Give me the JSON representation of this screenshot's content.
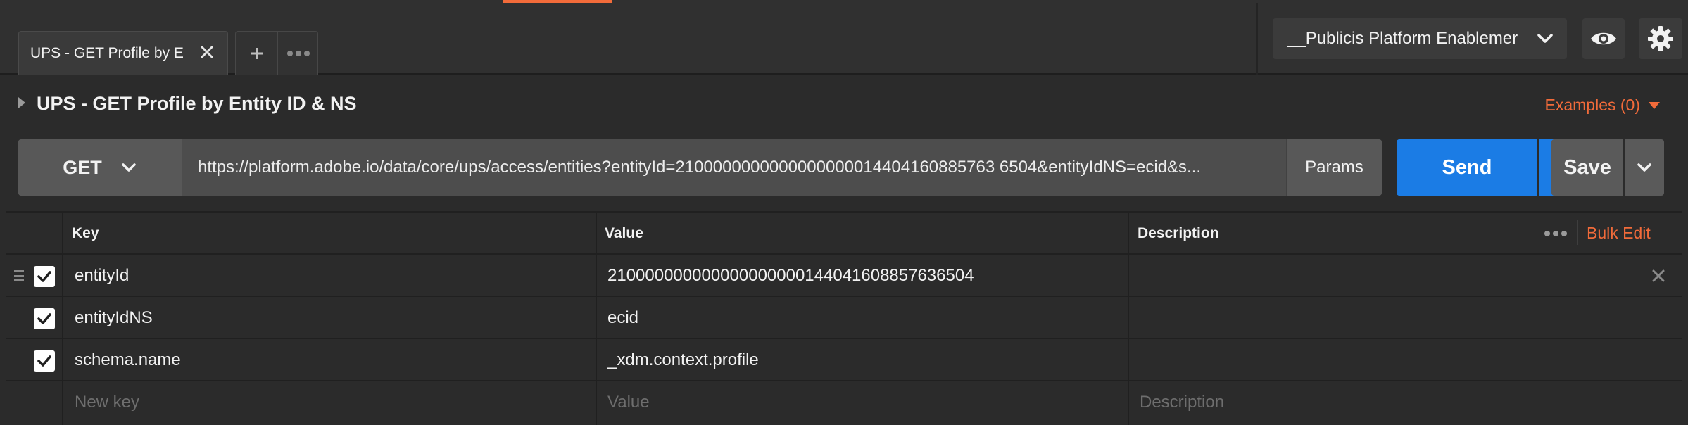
{
  "tabs": {
    "active_label": "UPS - GET Profile by E",
    "add_label": "+"
  },
  "environment": {
    "selected": "__Publicis Platform Enablemer"
  },
  "request": {
    "title": "UPS - GET Profile by Entity ID & NS",
    "examples_label": "Examples (0)",
    "method": "GET",
    "url": "https://platform.adobe.io/data/core/ups/access/entities?entityId=2100000000000000000014404160885763 6504&entityIdNS=ecid&s...",
    "params_label": "Params",
    "send_label": "Send",
    "save_label": "Save"
  },
  "params_table": {
    "headers": {
      "key": "Key",
      "value": "Value",
      "description": "Description",
      "bulk_edit": "Bulk Edit"
    },
    "rows": [
      {
        "key": "entityId",
        "value": "210000000000000000000144041608857636504",
        "checked": true
      },
      {
        "key": "entityIdNS",
        "value": "ecid",
        "checked": true
      },
      {
        "key": "schema.name",
        "value": "_xdm.context.profile",
        "checked": true
      }
    ],
    "placeholders": {
      "key": "New key",
      "value": "Value",
      "description": "Description"
    }
  },
  "colors": {
    "accent_orange": "#f26b3a",
    "send_blue": "#1b7ce5",
    "background": "#2b2b2b"
  },
  "icons": [
    "close-icon",
    "more-icon",
    "chevron-down-icon",
    "eye-icon",
    "gear-icon",
    "caret-right-icon",
    "drag-handle-icon",
    "checkmark-icon"
  ]
}
